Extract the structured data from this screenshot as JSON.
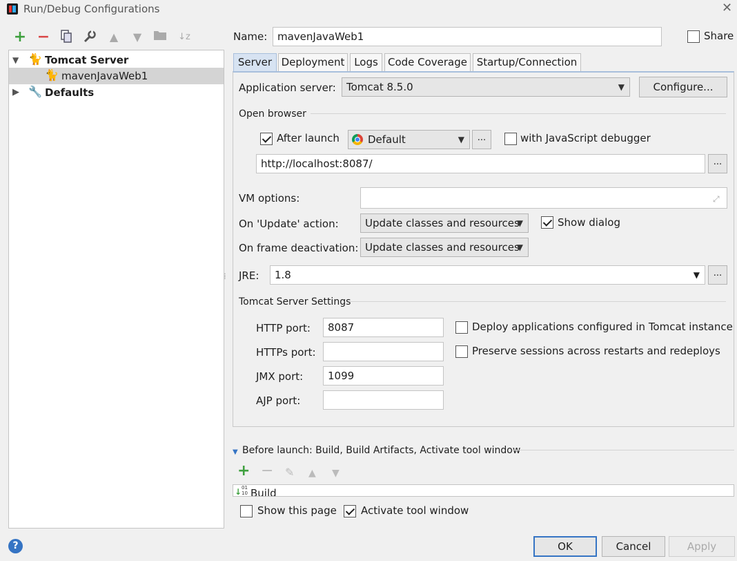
{
  "window": {
    "title": "Run/Debug Configurations"
  },
  "toolbar": {
    "icons": [
      "add-icon",
      "remove-icon",
      "copy-icon",
      "edit-defaults-icon",
      "move-up-icon",
      "move-down-icon",
      "folder-icon",
      "sort-icon"
    ]
  },
  "tree": {
    "group": {
      "label": "Tomcat Server"
    },
    "config": {
      "label": "mavenJavaWeb1"
    },
    "defaults": {
      "label": "Defaults"
    }
  },
  "name": {
    "label": "Name:",
    "value": "mavenJavaWeb1"
  },
  "share": {
    "label": "Share",
    "checked": false
  },
  "tabs": [
    {
      "label": "Server"
    },
    {
      "label": "Deployment"
    },
    {
      "label": "Logs"
    },
    {
      "label": "Code Coverage"
    },
    {
      "label": "Startup/Connection"
    }
  ],
  "server": {
    "app_server_label": "Application server:",
    "app_server_value": "Tomcat 8.5.0",
    "configure_label": "Configure...",
    "open_browser_label": "Open browser",
    "after_launch_label": "After launch",
    "browser_value": "Default",
    "dots": "...",
    "js_debugger_label": "with JavaScript debugger",
    "url_value": "http://localhost:8087/",
    "vm_options_label": "VM options:",
    "vm_options_value": "",
    "on_update_label": "On 'Update' action:",
    "on_update_value": "Update classes and resources",
    "show_dialog_label": "Show dialog",
    "on_frame_label": "On frame deactivation:",
    "on_frame_value": "Update classes and resources",
    "jre_label": "JRE:",
    "jre_value": "1.8",
    "tomcat_settings_label": "Tomcat Server Settings",
    "http_port_label": "HTTP port:",
    "http_port_value": "8087",
    "https_port_label": "HTTPs port:",
    "https_port_value": "",
    "jmx_port_label": "JMX port:",
    "jmx_port_value": "1099",
    "ajp_port_label": "AJP port:",
    "ajp_port_value": "",
    "deploy_label": "Deploy applications configured in Tomcat instance",
    "preserve_label": "Preserve sessions across restarts and redeploys"
  },
  "before_launch": {
    "title": "Before launch: Build, Build Artifacts, Activate tool window",
    "items": [
      {
        "label": "Build"
      }
    ],
    "show_page_label": "Show this page",
    "activate_label": "Activate tool window"
  },
  "footer": {
    "help": "?",
    "ok": "OK",
    "cancel": "Cancel",
    "apply": "Apply"
  },
  "colors": {
    "accent": "#3574c4",
    "add_green": "#3ea03e",
    "remove_red": "#d94848"
  }
}
